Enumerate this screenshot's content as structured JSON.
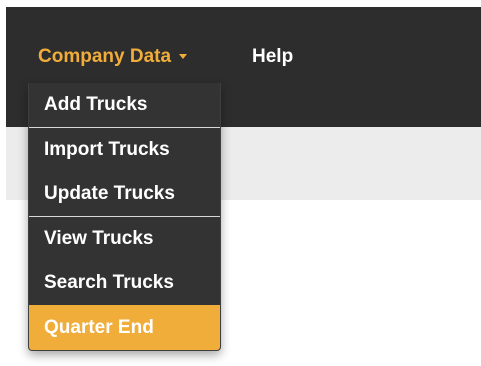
{
  "nav": {
    "company_data_label": "Company Data",
    "help_label": "Help",
    "accent_color": "#f0ad3a",
    "bar_color": "#2d2d2d"
  },
  "dropdown": {
    "items": [
      {
        "label": "Add Trucks"
      },
      {
        "label": "Import Trucks"
      },
      {
        "label": "Update Trucks"
      },
      {
        "label": "View Trucks"
      },
      {
        "label": "Search Trucks"
      },
      {
        "label": "Quarter End",
        "active": true
      }
    ]
  }
}
